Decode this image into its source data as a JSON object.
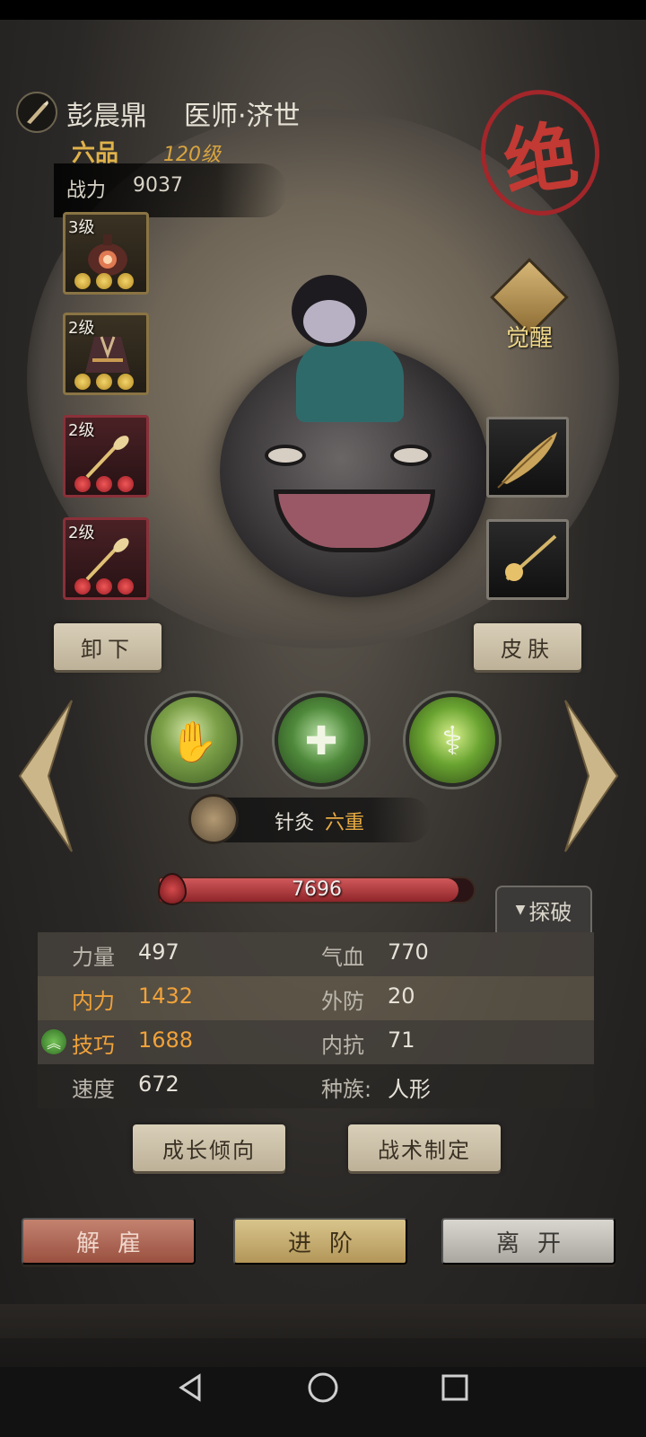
{
  "hero": {
    "name": "彭晨鼎",
    "title": "医师·济世",
    "rank": "六品",
    "level": "120级",
    "power_label": "战力",
    "power_value": "9037",
    "badge": "绝"
  },
  "equipment_left": [
    {
      "level": "3级",
      "quality": "gold",
      "icon": "gourd-icon"
    },
    {
      "level": "2级",
      "quality": "gold",
      "icon": "robe-icon"
    },
    {
      "level": "2级",
      "quality": "red",
      "icon": "feather-whisk-icon"
    },
    {
      "level": "2级",
      "quality": "red",
      "icon": "feather-whisk-icon"
    }
  ],
  "equipment_right": [
    {
      "icon": "feather-icon"
    },
    {
      "icon": "hairpin-icon"
    }
  ],
  "awaken_label": "觉醒",
  "buttons": {
    "unequip": "卸下",
    "skin": "皮肤",
    "growth": "成长倾向",
    "tactics": "战术制定",
    "dismiss": "解雇",
    "advance": "进阶",
    "leave": "离开",
    "explore": "探破"
  },
  "skills": [
    {
      "icon": "palm-icon",
      "glyph": "✋"
    },
    {
      "icon": "heal-icon",
      "glyph": "✚"
    },
    {
      "icon": "needle-icon",
      "glyph": "⚕"
    }
  ],
  "active_skill": {
    "name": "针灸",
    "rank": "六重"
  },
  "hp": {
    "value": "7696",
    "fill_fraction": 0.95
  },
  "stats": [
    {
      "l_label": "力量",
      "l_val": "497",
      "r_label": "气血",
      "r_val": "770",
      "highlight": false,
      "boost": false
    },
    {
      "l_label": "内力",
      "l_val": "1432",
      "r_label": "外防",
      "r_val": "20",
      "highlight": true,
      "boost": false
    },
    {
      "l_label": "技巧",
      "l_val": "1688",
      "r_label": "内抗",
      "r_val": "71",
      "highlight": true,
      "boost": true
    },
    {
      "l_label": "速度",
      "l_val": "672",
      "r_label": "种族:",
      "r_val": "人形",
      "highlight": false,
      "boost": false
    }
  ],
  "colors": {
    "accent_gold": "#e0b24a",
    "accent_orange": "#f0a23a",
    "badge_red": "#c23a33",
    "hp_red": "#d0585a"
  }
}
